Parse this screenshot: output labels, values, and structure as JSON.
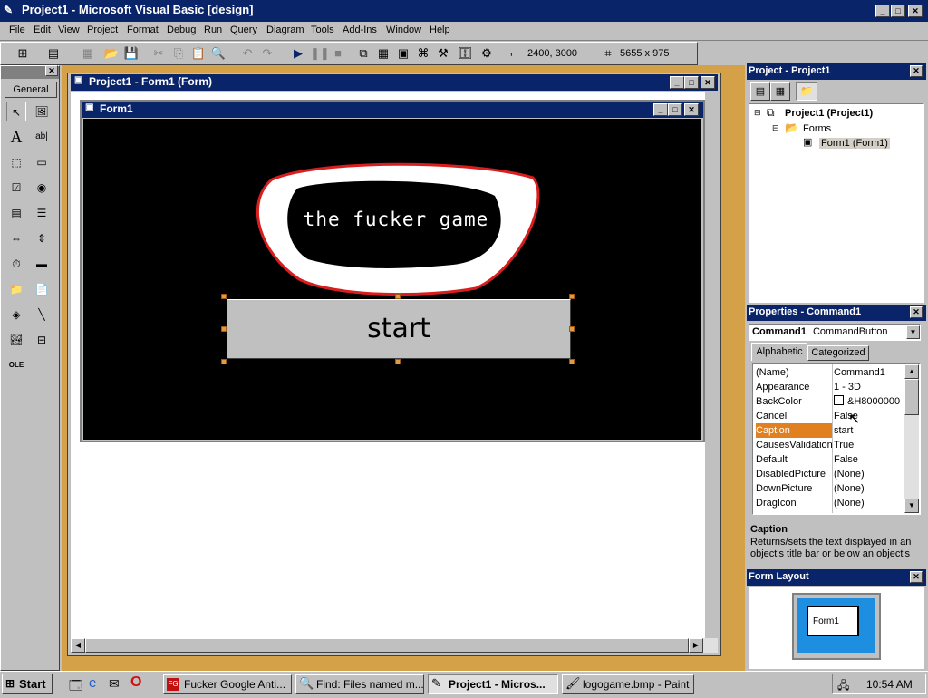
{
  "app": {
    "title": "Project1 - Microsoft Visual Basic [design]"
  },
  "menu": [
    "File",
    "Edit",
    "View",
    "Project",
    "Format",
    "Debug",
    "Run",
    "Query",
    "Diagram",
    "Tools",
    "Add-Ins",
    "Window",
    "Help"
  ],
  "toolbar": {
    "position": "2400, 3000",
    "size": "5655 x 975"
  },
  "toolbox": {
    "tab": "General",
    "tools": [
      "pointer",
      "picturebox",
      "label",
      "textbox",
      "frame",
      "commandbutton",
      "checkbox",
      "optionbutton",
      "combobox",
      "listbox",
      "hscrollbar",
      "vscrollbar",
      "timer",
      "drivelistbox",
      "dirlistbox",
      "filelistbox",
      "shape",
      "line",
      "image",
      "data",
      "ole"
    ]
  },
  "designer": {
    "window_title": "Project1 - Form1 (Form)",
    "form_title": "Form1",
    "logo_text": "the fucker game",
    "button_caption": "start"
  },
  "project": {
    "title": "Project - Project1",
    "root": "Project1 (Project1)",
    "folder": "Forms",
    "form": "Form1 (Form1)"
  },
  "properties": {
    "title": "Properties - Command1",
    "object": "Command1",
    "object_type": "CommandButton",
    "tab_alpha": "Alphabetic",
    "tab_cat": "Categorized",
    "rows": [
      {
        "name": "(Name)",
        "value": "Command1"
      },
      {
        "name": "Appearance",
        "value": "1 - 3D"
      },
      {
        "name": "BackColor",
        "value": "&H8000000"
      },
      {
        "name": "Cancel",
        "value": "False"
      },
      {
        "name": "Caption",
        "value": "start"
      },
      {
        "name": "CausesValidation",
        "value": "True"
      },
      {
        "name": "Default",
        "value": "False"
      },
      {
        "name": "DisabledPicture",
        "value": "(None)"
      },
      {
        "name": "DownPicture",
        "value": "(None)"
      },
      {
        "name": "DragIcon",
        "value": "(None)"
      }
    ],
    "desc_title": "Caption",
    "desc_text": "Returns/sets the text displayed in an object's title bar or below an object's"
  },
  "layout": {
    "title": "Form Layout",
    "form_label": "Form1"
  },
  "taskbar": {
    "start": "Start",
    "tasks": [
      "Fucker Google Anti...",
      "Find: Files named m...",
      "Project1 - Micros...",
      "logogame.bmp - Paint"
    ],
    "clock": "10:54 AM"
  },
  "colors": {
    "titlebar": "#0a246a",
    "desktop_bg": "#c0c0c0",
    "form_bg": "#000000",
    "logo_outline": "#d81e1e",
    "selection": "#e39a47",
    "mdi_border": "#d4a048"
  }
}
